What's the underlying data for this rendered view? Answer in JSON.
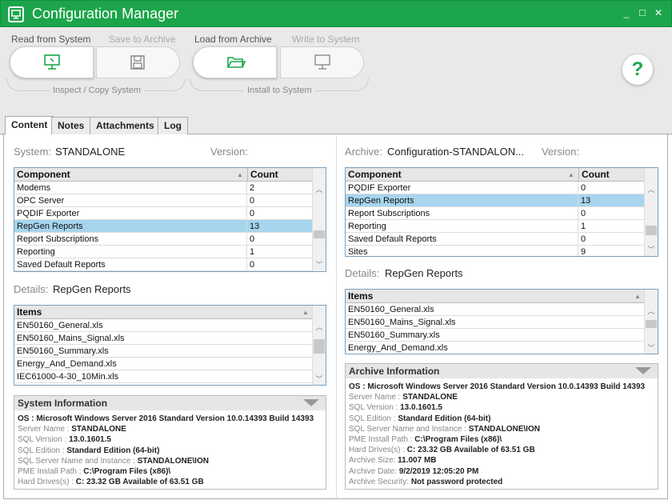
{
  "window": {
    "title": "Configuration Manager",
    "min": "_",
    "max": "□",
    "close": "✕"
  },
  "toolbar": {
    "read_label": "Read from System",
    "save_label": "Save to Archive",
    "load_label": "Load from Archive",
    "write_label": "Write to System",
    "group1": "Inspect / Copy System",
    "group2": "Install to System",
    "help": "?"
  },
  "tabs": [
    "Content",
    "Notes",
    "Attachments",
    "Log"
  ],
  "left": {
    "system_label": "System:",
    "system_value": "STANDALONE",
    "version_label": "Version:",
    "components": {
      "headers": [
        "Component",
        "Count"
      ],
      "rows": [
        [
          "Modems",
          "2"
        ],
        [
          "OPC Server",
          "0"
        ],
        [
          "PQDIF Exporter",
          "0"
        ],
        [
          "RepGen Reports",
          "13"
        ],
        [
          "Report Subscriptions",
          "0"
        ],
        [
          "Reporting",
          "1"
        ],
        [
          "Saved Default Reports",
          "0"
        ]
      ],
      "selected": 3
    },
    "details_label": "Details:",
    "details_value": "RepGen Reports",
    "items": {
      "header": "Items",
      "rows": [
        "EN50160_General.xls",
        "EN50160_Mains_Signal.xls",
        "EN50160_Summary.xls",
        "Energy_And_Demand.xls",
        "IEC61000-4-30_10Min.xls"
      ]
    },
    "sysinfo": {
      "title": "System Information",
      "lines": [
        {
          "k": "OS : ",
          "v": "Microsoft Windows Server 2016 Standard  Version 10.0.14393 Build 14393",
          "bold_key": true
        },
        {
          "k": "Server Name : ",
          "v": "STANDALONE"
        },
        {
          "k": "SQL Version : ",
          "v": "13.0.1601.5"
        },
        {
          "k": "SQL Edition : ",
          "v": "Standard Edition (64-bit)"
        },
        {
          "k": "SQL Server Name and Instance : ",
          "v": "STANDALONE\\ION"
        },
        {
          "k": "PME Install Path : ",
          "v": "C:\\Program Files (x86)\\"
        },
        {
          "k": "Hard Drives(s) : ",
          "v": "C: 23.32 GB Available of 63.51 GB"
        }
      ]
    }
  },
  "right": {
    "archive_label": "Archive:",
    "archive_value": "Configuration-STANDALON...",
    "version_label": "Version:",
    "components": {
      "headers": [
        "Component",
        "Count"
      ],
      "rows": [
        [
          "PQDIF Exporter",
          "0"
        ],
        [
          "RepGen Reports",
          "13"
        ],
        [
          "Report Subscriptions",
          "0"
        ],
        [
          "Reporting",
          "1"
        ],
        [
          "Saved Default Reports",
          "0"
        ],
        [
          "Sites",
          "9"
        ]
      ],
      "selected": 1
    },
    "details_label": "Details:",
    "details_value": "RepGen Reports",
    "items": {
      "header": "Items",
      "rows": [
        "EN50160_General.xls",
        "EN50160_Mains_Signal.xls",
        "EN50160_Summary.xls",
        "Energy_And_Demand.xls"
      ]
    },
    "archinfo": {
      "title": "Archive Information",
      "lines": [
        {
          "k": "OS : ",
          "v": "Microsoft Windows Server 2016 Standard  Version 10.0.14393 Build 14393",
          "bold_key": true
        },
        {
          "k": "Server Name : ",
          "v": "STANDALONE"
        },
        {
          "k": "SQL Version : ",
          "v": "13.0.1601.5"
        },
        {
          "k": "SQL Edition : ",
          "v": "Standard Edition (64-bit)"
        },
        {
          "k": "SQL Server Name and Instance : ",
          "v": "STANDALONE\\ION"
        },
        {
          "k": "PME Install Path : ",
          "v": "C:\\Program Files (x86)\\"
        },
        {
          "k": "Hard Drives(s) : ",
          "v": "C: 23.32 GB Available of 63.51 GB"
        },
        {
          "k": "Archive Size: ",
          "v": "11.007 MB"
        },
        {
          "k": "Archive Date: ",
          "v": "9/2/2019 12:05:20 PM"
        },
        {
          "k": "Archive Security: ",
          "v": "Not password protected"
        }
      ]
    }
  }
}
